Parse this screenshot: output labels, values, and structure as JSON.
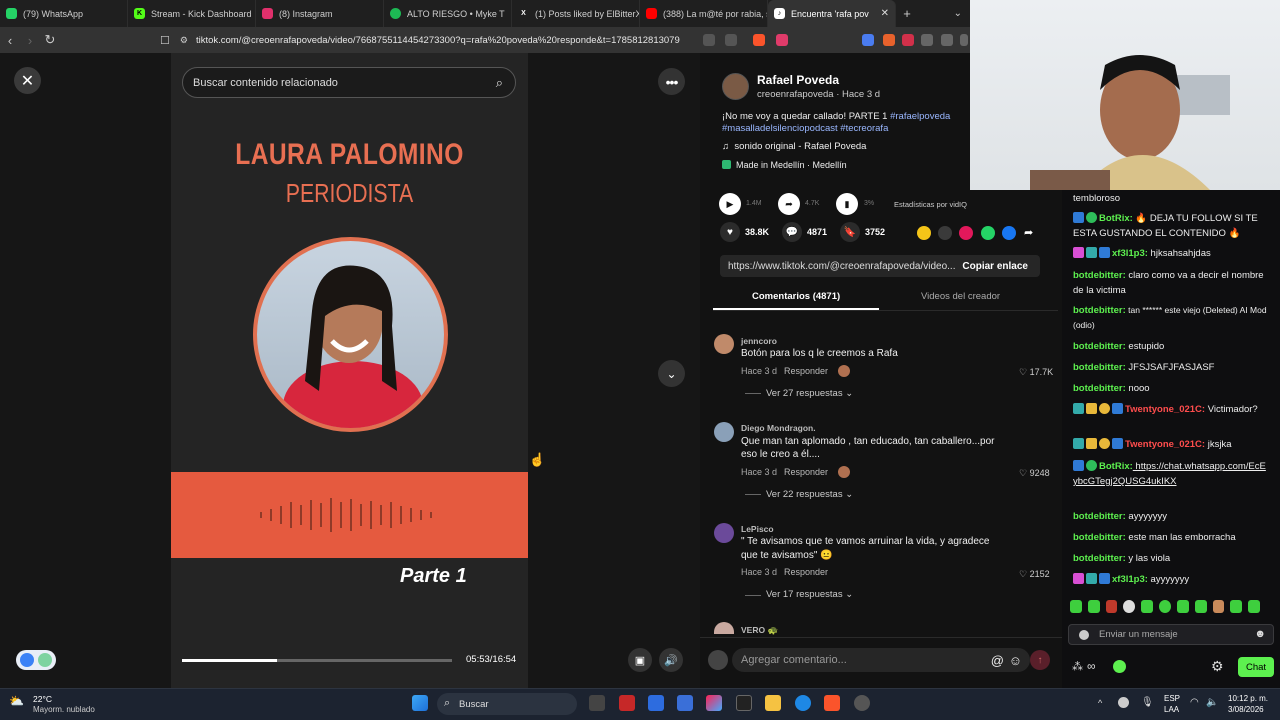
{
  "browser": {
    "tabs": [
      {
        "label": "(79) WhatsApp",
        "icon": "whatsapp-icon",
        "color": "#25d366"
      },
      {
        "label": "Stream - Kick Dashboard",
        "icon": "kick-icon",
        "color": "#53fc18"
      },
      {
        "label": "(8) Instagram",
        "icon": "instagram-icon",
        "color": "#e1306c"
      },
      {
        "label": "ALTO RIESGO • Myke T",
        "icon": "spotify-icon",
        "color": "#1db954"
      },
      {
        "label": "(1) Posts liked by ElBitterX",
        "icon": "x-icon",
        "color": "#ffffff"
      },
      {
        "label": "(388) La m@té por rabia, s",
        "icon": "youtube-icon",
        "color": "#ff0000"
      },
      {
        "label": "Encuentra 'rafa pov",
        "icon": "tiktok-icon",
        "color": "#000000"
      }
    ],
    "new_tab": "+",
    "url": "tiktok.com/@creoenrafapoveda/video/7668755114454273300?q=rafa%20poveda%20responde&t=1785812813079"
  },
  "video": {
    "search_placeholder": "Buscar contenido relacionado",
    "name": "LAURA PALOMINO",
    "role": "PERIODISTA",
    "part": "Parte 1",
    "time": "05:53/16:54",
    "progress": 0.35
  },
  "post": {
    "author": "Rafael Poveda",
    "handle": "creoenrafapoveda · Hace 3 d",
    "caption_text": "¡No me voy a quedar callado! PARTE 1 ",
    "hashtag1": "#rafaelpoveda",
    "hashtag2": "#masalladelsilenciopodcast",
    "hashtag3": "#tecreorafa",
    "sound": "sonido original - Rafael Poveda",
    "location": "Made in Medellín · Medellín",
    "stats_plays": "1.4M",
    "stats_shares": "4.7K",
    "stats_pct": "3%",
    "stats_label": "Estadísticas por vidIQ",
    "likes": "38.8K",
    "comments": "4871",
    "saves": "3752",
    "link": "https://www.tiktok.com/@creoenrafapoveda/video...",
    "copy_link": "Copiar enlace",
    "tab_comments": "Comentarios (4871)",
    "tab_videos": "Videos del creador",
    "add_comment": "Agregar comentario..."
  },
  "comments": [
    {
      "user": "jenncoro",
      "text1": "Botón para los q le creemos a Rafa",
      "text2": "",
      "time": "Hace 3 d",
      "reply": "Responder",
      "likes": "17.7K",
      "replies": "Ver 27 respuestas"
    },
    {
      "user": "Diego Mondragon.",
      "text1": "Que man tan aplomado , tan educado, tan caballero...por",
      "text2": "eso le creo a él....",
      "time": "Hace 3 d",
      "reply": "Responder",
      "likes": "9248",
      "replies": "Ver 22 respuestas"
    },
    {
      "user": "LePisco",
      "text1": "\" Te avisamos que te vamos arruinar la vida, y agradece",
      "text2": "que te avisamos\" 😐",
      "time": "Hace 3 d",
      "reply": "Responder",
      "likes": "2152",
      "replies": "Ver 17 respuestas"
    },
    {
      "user": "VERO 🐢",
      "text1": "",
      "text2": "",
      "time": "",
      "reply": "",
      "likes": "",
      "replies": ""
    }
  ],
  "chat": {
    "lines": [
      {
        "user": "",
        "text": "tembloroso",
        "color": "#eeeeee"
      },
      {
        "user": "BotRix:",
        "text": " 🔥 DEJA TU FOLLOW SI TE ESTA GUSTANDO EL CONTENIDO 🔥",
        "color": "#5df04f"
      },
      {
        "user": "xf3l1p3:",
        "text": " hjksahsahjdas",
        "color": "#5df04f"
      },
      {
        "user": "botdebitter:",
        "text": " claro como va a decir el nombre de la victima",
        "color": "#5df04f"
      },
      {
        "user": "botdebitter:",
        "text": " tan ****** este viejo (Deleted) AI Mod (odio)",
        "color": "#5df04f"
      },
      {
        "user": "botdebitter:",
        "text": " estupido",
        "color": "#5df04f"
      },
      {
        "user": "botdebitter:",
        "text": " JFSJSAFJFASJASF",
        "color": "#5df04f"
      },
      {
        "user": "botdebitter:",
        "text": " nooo",
        "color": "#5df04f"
      },
      {
        "user": "Twentyone_021C:",
        "text": " Victimador?",
        "color": "#ff4d4d"
      },
      {
        "user": "Twentyone_021C:",
        "text": " jksjka",
        "color": "#ff4d4d"
      },
      {
        "user": "BotRix:",
        "text": " https://chat.whatsapp.com/EcEybcGTegj2QUSG4ukIKX",
        "color": "#5df04f"
      },
      {
        "user": "botdebitter:",
        "text": " ayyyyyyy",
        "color": "#5df04f"
      },
      {
        "user": "botdebitter:",
        "text": " este man las emborracha",
        "color": "#5df04f"
      },
      {
        "user": "botdebitter:",
        "text": " y las viola",
        "color": "#5df04f"
      },
      {
        "user": "xf3l1p3:",
        "text": " ayyyyyyy",
        "color": "#5df04f"
      }
    ],
    "input_placeholder": "Enviar un mensaje",
    "send": "Chat"
  },
  "taskbar": {
    "weather_temp": "22°C",
    "weather_desc": "Mayorm. nublado",
    "search": "Buscar",
    "lang1": "ESP",
    "lang2": "LAA",
    "clock_time": "10:12 p. m.",
    "clock_date": "3/08/2026"
  }
}
